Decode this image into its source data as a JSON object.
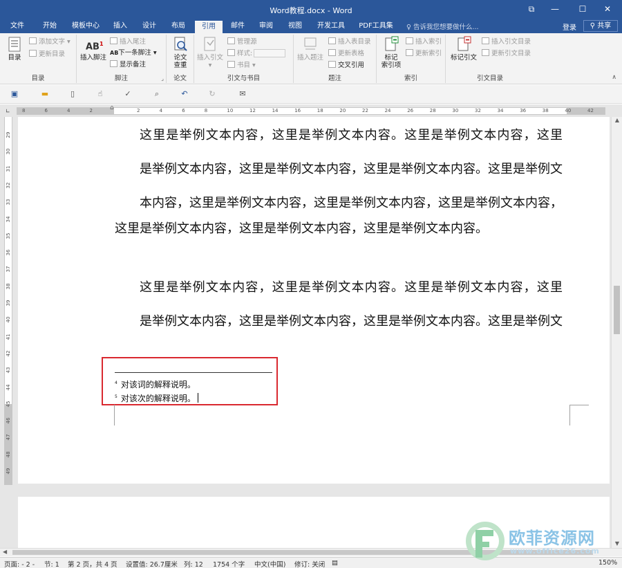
{
  "window": {
    "title": "Word教程.docx - Word",
    "controls": {
      "restore": "⧉",
      "minimize": "—",
      "maximize": "☐",
      "close": "✕"
    }
  },
  "tabs": [
    {
      "label": "文件"
    },
    {
      "label": "开始"
    },
    {
      "label": "模板中心"
    },
    {
      "label": "插入"
    },
    {
      "label": "设计"
    },
    {
      "label": "布局"
    },
    {
      "label": "引用"
    },
    {
      "label": "邮件"
    },
    {
      "label": "审阅"
    },
    {
      "label": "视图"
    },
    {
      "label": "开发工具"
    },
    {
      "label": "PDF工具集"
    }
  ],
  "active_tab": "引用",
  "tell_me": "告诉我您想要做什么...",
  "account": {
    "login": "登录",
    "share": "共享"
  },
  "ribbon": {
    "toc": {
      "label": "目录",
      "big": "目录",
      "add_text": "添加文字",
      "update": "更新目录"
    },
    "footnotes": {
      "label": "脚注",
      "insert_footnote": "插入脚注",
      "insert_endnote": "插入尾注",
      "next_footnote": "下一条脚注",
      "show_notes": "显示备注",
      "icon_text": "AB",
      "next_icon_text": "AB"
    },
    "research": {
      "label": "论文",
      "big_line1": "论文",
      "big_line2": "查重"
    },
    "citations": {
      "label": "引文与书目",
      "insert_citation": "插入引文",
      "manage_sources": "管理源",
      "style": "样式:",
      "bibliography": "书目"
    },
    "captions": {
      "label": "题注",
      "insert_caption": "插入题注",
      "insert_table_figures": "插入表目录",
      "update_table": "更新表格",
      "cross_reference": "交叉引用"
    },
    "index": {
      "label": "索引",
      "mark_entry_line1": "标记",
      "mark_entry_line2": "索引项",
      "insert_index": "插入索引",
      "update_index": "更新索引"
    },
    "toa": {
      "label": "引文目录",
      "mark_citation": "标记引文",
      "insert_toa": "插入引文目录",
      "update_toa": "更新引文目录"
    }
  },
  "qat_icons": [
    "save-icon",
    "open-icon",
    "new-icon",
    "touch-icon",
    "spelling-icon",
    "print-preview-icon",
    "undo-icon",
    "redo-icon",
    "email-icon"
  ],
  "hruler_numbers": [
    "8",
    "6",
    "4",
    "2",
    "2",
    "4",
    "6",
    "8",
    "10",
    "12",
    "14",
    "16",
    "18",
    "20",
    "22",
    "24",
    "26",
    "28",
    "30",
    "32",
    "34",
    "36",
    "38",
    "40",
    "42"
  ],
  "vruler_numbers": [
    "29",
    "30",
    "31",
    "32",
    "33",
    "34",
    "35",
    "36",
    "37",
    "38",
    "39",
    "40",
    "41",
    "42",
    "43",
    "44",
    "45",
    "46",
    "47",
    "48",
    "49"
  ],
  "document": {
    "paragraphs": [
      [
        "这里是举例文本内容，这里是举例文本内容。这里是举例文本内容，这里",
        "是举例文本内容，这里是举例文本内容，这里是举例文本内容。这里是举例文",
        "本内容，这里是举例文本内容，这里是举例文本内容，这里是举例文本内容，"
      ],
      [
        "这里是举例文本内容，这里是举例文本内容，这里是举例文本内容。"
      ],
      [
        "这里是举例文本内容，这里是举例文本内容。这里是举例文本内容，这里",
        "是举例文本内容，这里是举例文本内容，这里是举例文本内容。这里是举例文"
      ]
    ],
    "footnotes": [
      {
        "mark": "4",
        "text": "对该词的解释说明。"
      },
      {
        "mark": "5",
        "text": "对该次的解释说明。"
      }
    ]
  },
  "status": {
    "page": "页面: - 2 -",
    "section": "节: 1",
    "page_of": "第 2 页，共 4 页",
    "setting": "设置值: 26.7厘米",
    "column": "列: 12",
    "words": "1754 个字",
    "language": "中文(中国)",
    "track": "修订: 关闭",
    "zoom": "150%"
  },
  "watermark": {
    "line1": "欧菲资源网",
    "line2": "www.office26.com"
  }
}
